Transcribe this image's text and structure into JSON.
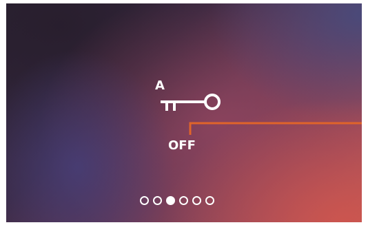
{
  "key_panel": {
    "letter": "A",
    "icon": "key-icon",
    "status": "OFF"
  },
  "pager": {
    "count": 6,
    "active_index": 2
  },
  "colors": {
    "accent": "#e0642a",
    "foreground": "#ffffff"
  }
}
